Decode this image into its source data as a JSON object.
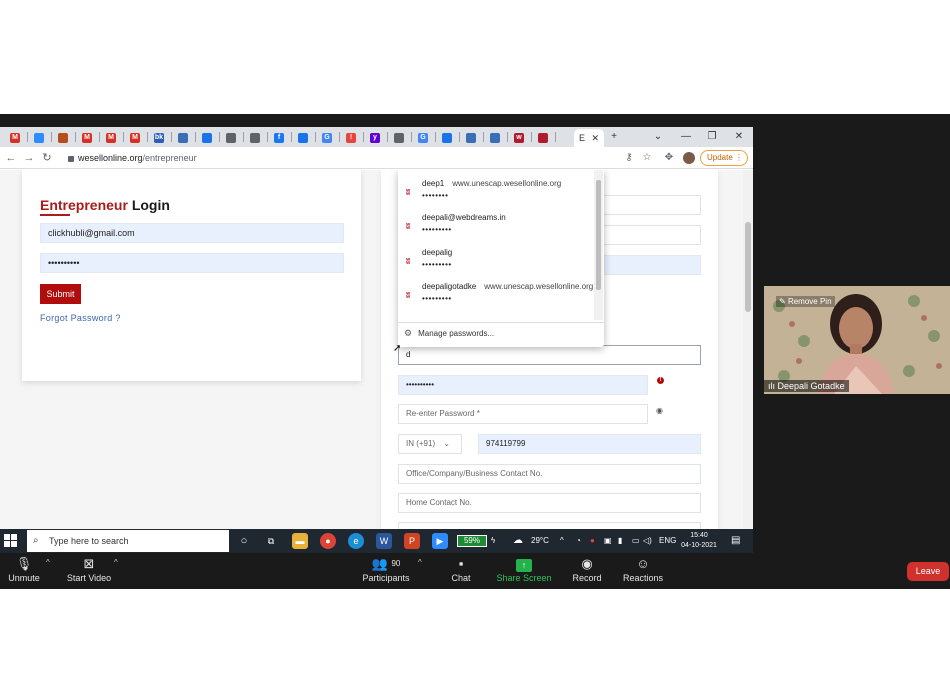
{
  "browser": {
    "url_domain": "wesellonline.org",
    "url_path": "/entrepreneur",
    "active_tab_label": "E",
    "update_label": "Update",
    "tabs": [
      {
        "icon": "gmail-icon",
        "glyph": "M",
        "color": "#d93025"
      },
      {
        "icon": "zoom-icon",
        "glyph": "",
        "color": "#2d8cff"
      },
      {
        "icon": "app-icon",
        "glyph": "",
        "color": "#b54d1f"
      },
      {
        "icon": "gmail-icon",
        "glyph": "M",
        "color": "#d93025"
      },
      {
        "icon": "gmail-icon",
        "glyph": "M",
        "color": "#d93025"
      },
      {
        "icon": "gmail-icon",
        "glyph": "M",
        "color": "#d93025"
      },
      {
        "icon": "bk-icon",
        "glyph": "bk",
        "color": "#2d5bb8"
      },
      {
        "icon": "doc-icon",
        "glyph": "",
        "color": "#3a6fb5"
      },
      {
        "icon": "download-icon",
        "glyph": "",
        "color": "#1a73e8"
      },
      {
        "icon": "globe-icon",
        "glyph": "",
        "color": "#5f6368"
      },
      {
        "icon": "globe-icon",
        "glyph": "",
        "color": "#5f6368"
      },
      {
        "icon": "facebook-icon",
        "glyph": "f",
        "color": "#1877f2"
      },
      {
        "icon": "app-icon",
        "glyph": "",
        "color": "#1a73e8"
      },
      {
        "icon": "google-icon",
        "glyph": "G",
        "color": "#4285f4"
      },
      {
        "icon": "alert-icon",
        "glyph": "!",
        "color": "#e8453c"
      },
      {
        "icon": "yahoo-icon",
        "glyph": "y",
        "color": "#6001d2"
      },
      {
        "icon": "globe-icon",
        "glyph": "",
        "color": "#5f6368"
      },
      {
        "icon": "google-icon",
        "glyph": "G",
        "color": "#4285f4"
      },
      {
        "icon": "app-icon",
        "glyph": "",
        "color": "#1a73e8"
      },
      {
        "icon": "doc-icon",
        "glyph": "",
        "color": "#3a6fb5"
      },
      {
        "icon": "doc-icon",
        "glyph": "",
        "color": "#3a6fb5"
      },
      {
        "icon": "wesell-icon",
        "glyph": "w",
        "color": "#b01c2e"
      },
      {
        "icon": "app-icon",
        "glyph": "",
        "color": "#b01c2e"
      },
      {
        "icon": "globe-icon",
        "glyph": "",
        "color": "#5f6368"
      }
    ]
  },
  "login": {
    "title_accent": "Entrepreneur",
    "title_rest": "Login",
    "email_value": "clickhubli@gmail.com",
    "password_value": "••••••••••",
    "submit_label": "Submit",
    "forgot_label": "Forgot Password ?"
  },
  "password_dropdown": {
    "items": [
      {
        "user": "deep1",
        "site": "www.unescap.wesellonline.org",
        "dots": "••••••••"
      },
      {
        "user": "deepali@webdreams.in",
        "site": "",
        "dots": "•••••••••"
      },
      {
        "user": "deepalig",
        "site": "",
        "dots": "•••••••••"
      },
      {
        "user": "deepaligotadke",
        "site": "www.unescap.wesellonline.org",
        "dots": "•••••••••"
      }
    ],
    "manage_label": "Manage passwords..."
  },
  "register": {
    "focused_value": "d",
    "password_value": "••••••••••",
    "reenter_placeholder": "Re-enter Password *",
    "country_code": "IN (+91)",
    "phone_value": "974119799",
    "office_placeholder": "Office/Company/Business Contact No.",
    "home_placeholder": "Home Contact No."
  },
  "taskbar": {
    "search_placeholder": "Type here to search",
    "battery": "59%",
    "temperature": "29°C",
    "language": "ENG",
    "time": "15:40",
    "date": "04-10-2021"
  },
  "video": {
    "remove_pin_label": "Remove Pin",
    "participant_name": "Deepali Gotadke"
  },
  "zoom_controls": {
    "unmute": "Unmute",
    "start_video": "Start Video",
    "participants_count": "90",
    "participants": "Participants",
    "chat": "Chat",
    "share_screen": "Share Screen",
    "record": "Record",
    "reactions": "Reactions",
    "leave": "Leave"
  }
}
